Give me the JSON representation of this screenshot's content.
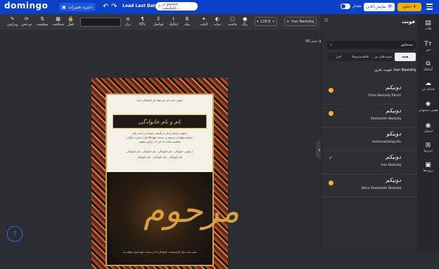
{
  "topbar": {
    "logo": "domingo",
    "save_label": "ذخیره تغییرات",
    "load_last": "Load Last Data",
    "search_placeholder": "جستجو در اپلیکیشن...",
    "toggle_label": "مقدار",
    "preview_label": "نمایش آنلاین",
    "download_label": "دانلود"
  },
  "toolbar": {
    "font_name": "Iran Nastaliq",
    "font_size": "128.6",
    "tools": [
      {
        "label": "قفل",
        "icon": "lock-icon",
        "glyph": "🔒"
      },
      {
        "label": "شفافیت",
        "icon": "transparency-icon",
        "glyph": "▦"
      },
      {
        "label": "موقعیت",
        "icon": "position-icon",
        "glyph": "⇅"
      },
      {
        "label": "چرخش",
        "icon": "rotate-icon",
        "glyph": "⟳"
      },
      {
        "label": "ویرایش",
        "icon": "edit-icon",
        "glyph": "✎"
      },
      {
        "label": "تراز",
        "icon": "align-icon",
        "glyph": "≡"
      },
      {
        "label": "RTL",
        "icon": "rtl-icon",
        "glyph": "¶"
      },
      {
        "label": "فواصل",
        "icon": "spacing-icon",
        "glyph": "↕"
      },
      {
        "label": "ایتالیک",
        "icon": "italic-icon",
        "glyph": "I"
      },
      {
        "label": "بولد",
        "icon": "bold-icon",
        "glyph": "B"
      },
      {
        "label": "افکت",
        "icon": "effect-icon",
        "glyph": "✦"
      },
      {
        "label": "سایه",
        "icon": "shadow-icon",
        "glyph": "◐"
      },
      {
        "label": "حاشیه",
        "icon": "border-icon",
        "glyph": "▢"
      },
      {
        "label": "رنگ",
        "icon": "color-icon",
        "glyph": "●"
      }
    ]
  },
  "canvas": {
    "zoom_label": "حجم 98",
    "poster": {
      "top_text": "عیونی جدید دارد هر میلاد ای خانوادگی جدید",
      "title": "نام و نام خانوادگی",
      "body_line1": "با نهایت تاسف و تاثر در گذشت جوانان از دست رفته",
      "body_line2": "مراسم چهلم آن مرحوم در مسجد جهرانگاه قرب منیرت برگزار",
      "body_line3": "یکشنبه ساعت ۱۸ الی ۱۹ برگزار میشود",
      "names_line1": "از طرف خانوادگی : نام خانوادگی - نام خانوادگی - نام خانوادگی",
      "names_line2": "نام خانوادگی - نام خانوادگی - نام خانوادگی",
      "calligraphy": "مرحوم",
      "caption": "متنی جدید برای گرامیداشت خانوادگی که از شرکت تولید قرار خواهد شد"
    }
  },
  "sidepanel": {
    "title": "فونت",
    "search_value": "نستعلیق",
    "tabs": [
      "همه",
      "فونت‌های من",
      "علاقه‌مندی‌ها",
      "اخیر"
    ],
    "current_font_label": "فونت جاری: Iran Nastaliq",
    "fonts": [
      {
        "sample": "دونیکم",
        "name": "Dima Nastaliq Tahriri",
        "marker": "dot"
      },
      {
        "sample": "دونیکم",
        "name": "Shekasteh Nastaliq",
        "marker": "dot"
      },
      {
        "sample": "دوینکو",
        "name": "motionastaliqurdu",
        "marker": "none"
      },
      {
        "sample": "دونیکم",
        "name": "Iran Nastaliq",
        "marker": "check"
      },
      {
        "sample": "دونیکم",
        "name": "Dima Shekasteh Nastaliq",
        "marker": "dot"
      }
    ]
  },
  "rail": [
    {
      "label": "قالب",
      "icon": "template-icon",
      "glyph": "▤"
    },
    {
      "label": "متن",
      "icon": "text-icon",
      "glyph": "Tт"
    },
    {
      "label": "گرافیک",
      "icon": "graphics-icon",
      "glyph": "⧉"
    },
    {
      "label": "فضای من",
      "icon": "cloud-upload-icon",
      "glyph": "☁"
    },
    {
      "label": "هوش مصنوعی",
      "icon": "ai-icon",
      "glyph": "✺"
    },
    {
      "label": "استایل",
      "icon": "style-icon",
      "glyph": "◉"
    },
    {
      "label": "ابزارها",
      "icon": "tools-icon",
      "glyph": "⊞"
    },
    {
      "label": "پروژه‌ها",
      "icon": "projects-icon",
      "glyph": "▣"
    }
  ]
}
